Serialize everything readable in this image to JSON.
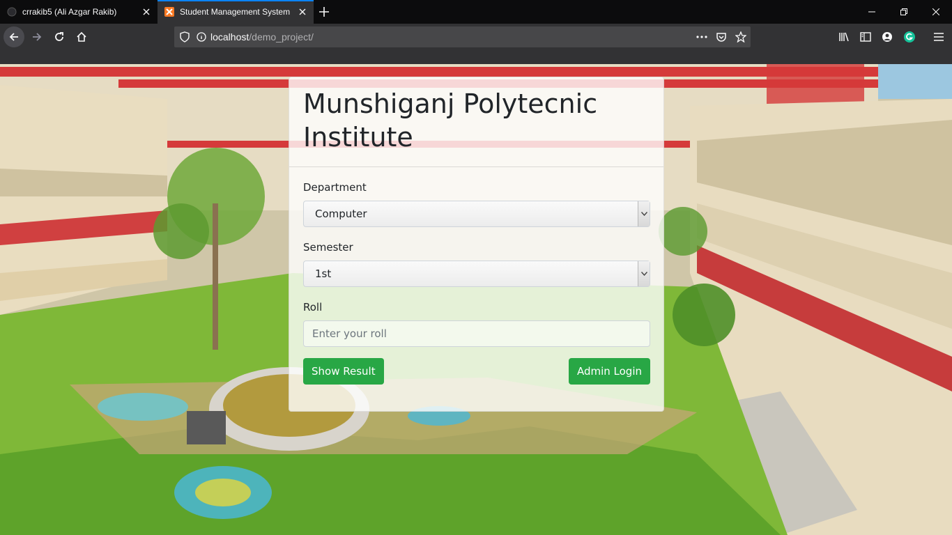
{
  "browser": {
    "tabs": [
      {
        "title": "crrakib5 (Ali Azgar Rakib)",
        "active": false
      },
      {
        "title": "Student Management System",
        "active": true
      }
    ],
    "url_host": "localhost",
    "url_path": "/demo_project/"
  },
  "page": {
    "title": "Munshiganj Polytecnic Institute",
    "department": {
      "label": "Department",
      "selected": "Computer"
    },
    "semester": {
      "label": "Semester",
      "selected": "1st"
    },
    "roll": {
      "label": "Roll",
      "placeholder": "Enter your roll",
      "value": ""
    },
    "buttons": {
      "show_result": "Show Result",
      "admin_login": "Admin Login"
    }
  },
  "colors": {
    "accent": "#0a84ff",
    "success": "#28a745",
    "browser_chrome": "#323234",
    "tabstrip": "#0c0c0d"
  }
}
